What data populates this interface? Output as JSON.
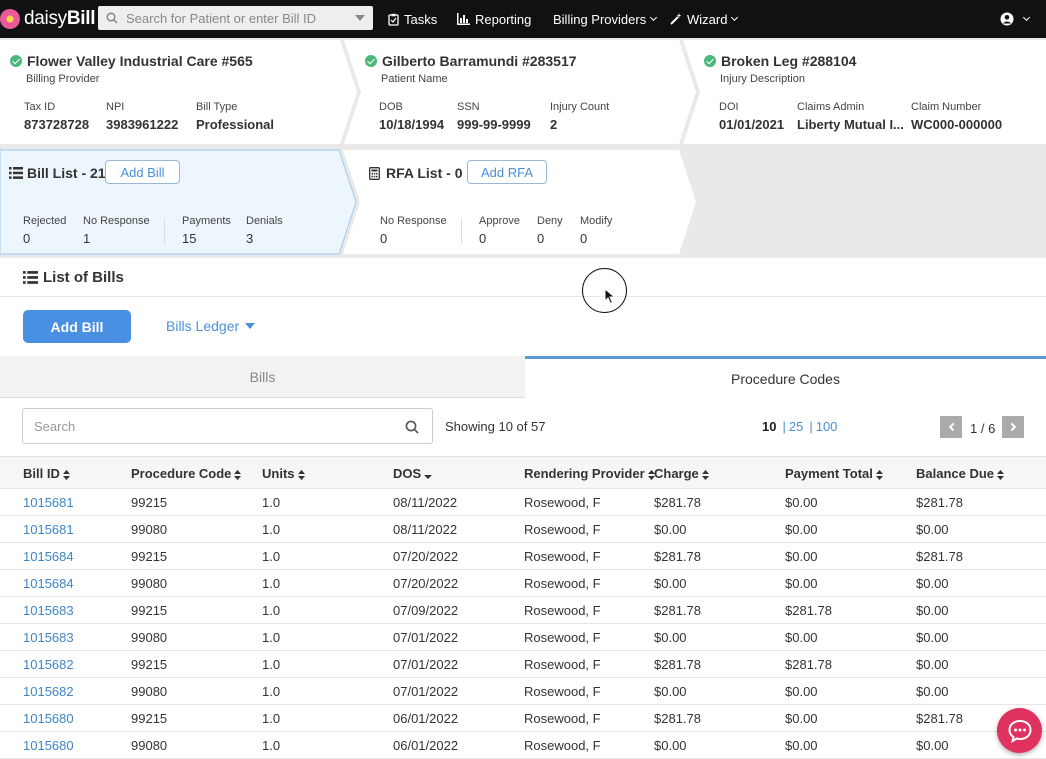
{
  "nav": {
    "logo_text_light": "daisy",
    "logo_text_bold": "Bill",
    "search_placeholder": "Search for Patient or enter Bill ID",
    "tasks": "Tasks",
    "reporting": "Reporting",
    "billing_providers": "Billing Providers",
    "wizard": "Wizard"
  },
  "provider": {
    "title": "Flower Valley Industrial Care #565",
    "subtitle": "Billing Provider",
    "fields": [
      {
        "label": "Tax ID",
        "value": "873728728"
      },
      {
        "label": "NPI",
        "value": "3983961222"
      },
      {
        "label": "Bill Type",
        "value": "Professional"
      }
    ]
  },
  "patient": {
    "title": "Gilberto Barramundi #283517",
    "subtitle": "Patient Name",
    "fields": [
      {
        "label": "DOB",
        "value": "10/18/1994"
      },
      {
        "label": "SSN",
        "value": "999-99-9999"
      },
      {
        "label": "Injury Count",
        "value": "2"
      }
    ]
  },
  "injury": {
    "title": "Broken Leg #288104",
    "subtitle": "Injury Description",
    "fields": [
      {
        "label": "DOI",
        "value": "01/01/2021"
      },
      {
        "label": "Claims Admin",
        "value": "Liberty Mutual I..."
      },
      {
        "label": "Claim Number",
        "value": "WC000-000000"
      }
    ]
  },
  "bill_list": {
    "title": "Bill List - 21",
    "add_button": "Add Bill",
    "stats": [
      {
        "label": "Rejected",
        "value": "0"
      },
      {
        "label": "No Response",
        "value": "1"
      },
      {
        "label": "Payments",
        "value": "15"
      },
      {
        "label": "Denials",
        "value": "3"
      }
    ]
  },
  "rfa_list": {
    "title": "RFA List - 0",
    "add_button": "Add RFA",
    "stats": [
      {
        "label": "No Response",
        "value": "0"
      },
      {
        "label": "Approve",
        "value": "0"
      },
      {
        "label": "Deny",
        "value": "0"
      },
      {
        "label": "Modify",
        "value": "0"
      }
    ]
  },
  "section": {
    "title": "List of Bills",
    "add_bill": "Add Bill",
    "ledger": "Bills Ledger"
  },
  "tabs": {
    "bills": "Bills",
    "procedure_codes": "Procedure Codes"
  },
  "table_controls": {
    "search_placeholder": "Search",
    "showing": "Showing 10 of 57",
    "page_sizes": [
      "10",
      "25",
      "100"
    ],
    "page_sep": "|",
    "pagination": "1 / 6"
  },
  "table": {
    "columns": [
      "Bill ID",
      "Procedure Code",
      "Units",
      "DOS",
      "Rendering Provider",
      "Charge",
      "Payment Total",
      "Balance Due"
    ],
    "rows": [
      [
        "1015681",
        "99215",
        "1.0",
        "08/11/2022",
        "Rosewood, F",
        "$281.78",
        "$0.00",
        "$281.78"
      ],
      [
        "1015681",
        "99080",
        "1.0",
        "08/11/2022",
        "Rosewood, F",
        "$0.00",
        "$0.00",
        "$0.00"
      ],
      [
        "1015684",
        "99215",
        "1.0",
        "07/20/2022",
        "Rosewood, F",
        "$281.78",
        "$0.00",
        "$281.78"
      ],
      [
        "1015684",
        "99080",
        "1.0",
        "07/20/2022",
        "Rosewood, F",
        "$0.00",
        "$0.00",
        "$0.00"
      ],
      [
        "1015683",
        "99215",
        "1.0",
        "07/09/2022",
        "Rosewood, F",
        "$281.78",
        "$281.78",
        "$0.00"
      ],
      [
        "1015683",
        "99080",
        "1.0",
        "07/01/2022",
        "Rosewood, F",
        "$0.00",
        "$0.00",
        "$0.00"
      ],
      [
        "1015682",
        "99215",
        "1.0",
        "07/01/2022",
        "Rosewood, F",
        "$281.78",
        "$281.78",
        "$0.00"
      ],
      [
        "1015682",
        "99080",
        "1.0",
        "07/01/2022",
        "Rosewood, F",
        "$0.00",
        "$0.00",
        "$0.00"
      ],
      [
        "1015680",
        "99215",
        "1.0",
        "06/01/2022",
        "Rosewood, F",
        "$281.78",
        "$0.00",
        "$281.78"
      ],
      [
        "1015680",
        "99080",
        "1.0",
        "06/01/2022",
        "Rosewood, F",
        "$0.00",
        "$0.00",
        "$0.00"
      ]
    ]
  },
  "colors": {
    "nav_bg": "#111111",
    "accent": "#4a90d9",
    "check": "#4bb77a",
    "chat": "#e0325f"
  }
}
